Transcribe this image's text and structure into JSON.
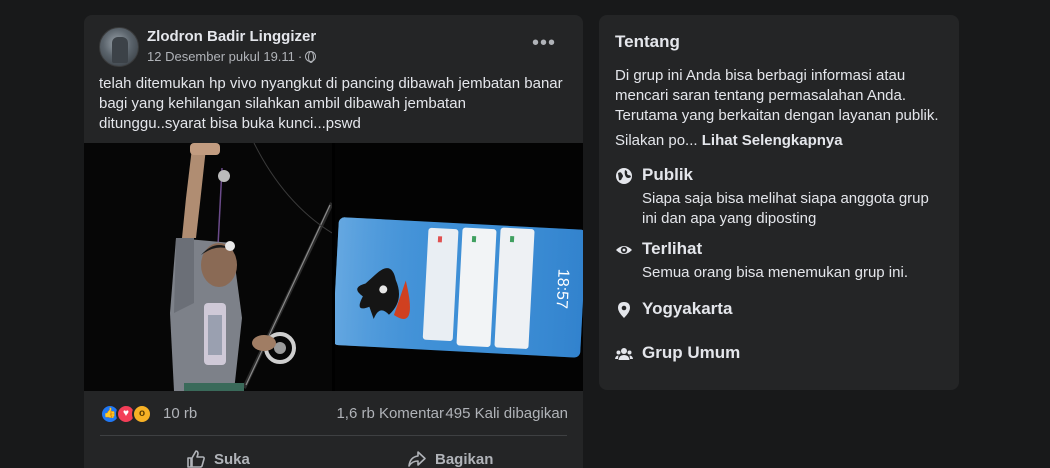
{
  "post": {
    "author": "Zlodron Badir Linggizer",
    "timestamp": "12 Desember pukul 19.11",
    "separator": "·",
    "privacy_icon": "globe-icon",
    "more_icon": "more-options-icon",
    "text": "telah ditemukan hp vivo nyangkut di pancing dibawah jembatan banar bagi yang kehilangan silahkan ambil dibawah jembatan ditunggu..syarat bisa buka kunci...pswd",
    "photos": [
      {
        "description_icon": "photo-man-with-fishing-rod"
      },
      {
        "description_icon": "photo-phone-screen"
      }
    ],
    "reactions": {
      "icons": [
        "like-reaction-icon",
        "love-reaction-icon",
        "wow-reaction-icon"
      ],
      "count": "10 rb",
      "comments": "1,6 rb Komentar",
      "shares": "495 Kali dibagikan"
    },
    "actions": {
      "like_label": "Suka",
      "share_label": "Bagikan"
    }
  },
  "about": {
    "title": "Tentang",
    "description": "Di grup ini Anda bisa berbagi informasi atau mencari saran tentang permasalahan Anda. Terutama yang berkaitan dengan layanan publik.",
    "more_prefix": "Silakan po...",
    "more_link": "Lihat Selengkapnya",
    "items": [
      {
        "icon": "globe-icon",
        "title": "Publik",
        "desc": "Siapa saja bisa melihat siapa anggota grup ini dan apa yang diposting"
      },
      {
        "icon": "eye-icon",
        "title": "Terlihat",
        "desc": "Semua orang bisa menemukan grup ini."
      },
      {
        "icon": "location-pin-icon",
        "title": "Yogyakarta",
        "desc": ""
      },
      {
        "icon": "people-icon",
        "title": "Grup Umum",
        "desc": ""
      }
    ]
  },
  "colors": {
    "background": "#18191a",
    "card": "#242526",
    "text_primary": "#e4e6eb",
    "text_secondary": "#b0b3b8",
    "like_blue": "#2078f4",
    "love_red": "#f33e58",
    "wow_yellow": "#f7b125"
  }
}
